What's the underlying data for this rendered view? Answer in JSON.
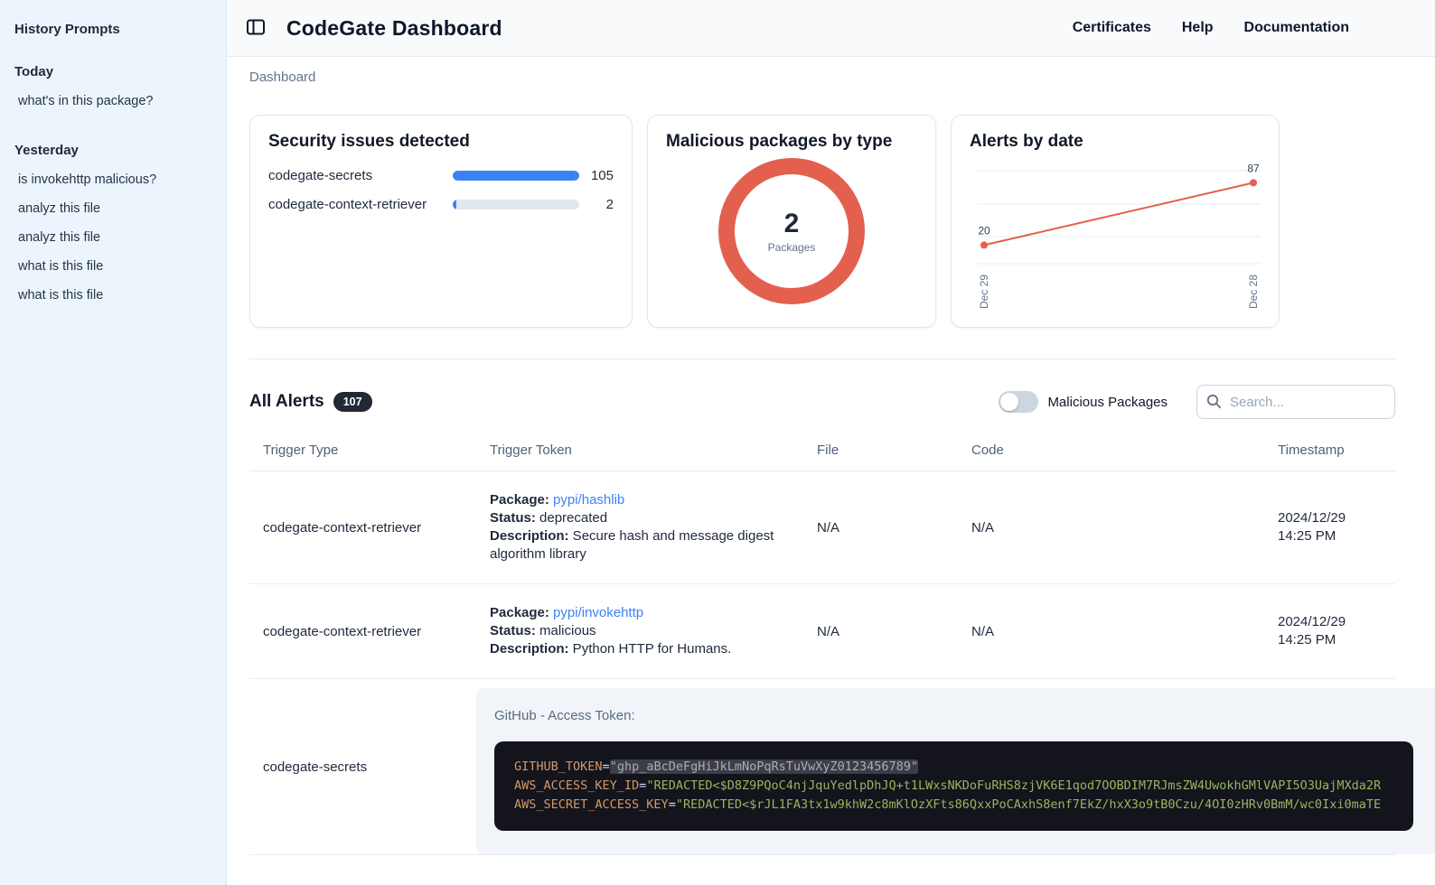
{
  "colors": {
    "accent_blue": "#3b82f6",
    "coral": "#e4604e",
    "link_blue": "#3b82f6",
    "code_key": "#d19a66",
    "code_string": "#98b45f"
  },
  "sidebar": {
    "title": "History Prompts",
    "sections": [
      {
        "label": "Today",
        "items": [
          "what's in this package?"
        ]
      },
      {
        "label": "Yesterday",
        "items": [
          "is invokehttp malicious?",
          "analyz this file",
          "analyz this file",
          "what is this file",
          "what is this file"
        ]
      }
    ]
  },
  "header": {
    "title": "CodeGate Dashboard",
    "nav": [
      {
        "label": "Certificates"
      },
      {
        "label": "Help"
      },
      {
        "label": "Documentation"
      }
    ]
  },
  "breadcrumb": "Dashboard",
  "cards": {
    "security": {
      "title": "Security issues detected"
    },
    "malicious": {
      "title": "Malicious packages by type"
    },
    "alerts_by_date": {
      "title": "Alerts by date"
    }
  },
  "chart_data": [
    {
      "type": "bar",
      "title": "Security issues detected",
      "categories": [
        "codegate-secrets",
        "codegate-context-retriever"
      ],
      "values": [
        105,
        2
      ],
      "max": 105
    },
    {
      "type": "pie",
      "title": "Malicious packages by type",
      "categories": [
        "malicious"
      ],
      "values": [
        2
      ],
      "center": "2",
      "center_label": "Packages"
    },
    {
      "type": "line",
      "title": "Alerts by date",
      "categories": [
        "Dec 29",
        "Dec 28"
      ],
      "values": [
        20,
        87
      ],
      "point_labels": [
        "20",
        "87"
      ],
      "ylim": [
        0,
        100
      ],
      "grid": true
    }
  ],
  "alerts_section": {
    "title": "All Alerts",
    "count_badge": "107",
    "toggle_label": "Malicious Packages",
    "search_placeholder": "Search...",
    "table": {
      "columns": [
        "Trigger Type",
        "Trigger Token",
        "File",
        "Code",
        "Timestamp"
      ],
      "rows": [
        {
          "type": "package",
          "trigger_type": "codegate-context-retriever",
          "package_label": "Package:",
          "package_link": "pypi/hashlib",
          "status_label": "Status:",
          "status": "deprecated",
          "description_label": "Description:",
          "description": "Secure hash and message digest algorithm library",
          "file": "N/A",
          "code": "N/A",
          "timestamp_date": "2024/12/29",
          "timestamp_time": "14:25 PM"
        },
        {
          "type": "package",
          "trigger_type": "codegate-context-retriever",
          "package_label": "Package:",
          "package_link": "pypi/invokehttp",
          "status_label": "Status:",
          "status": "malicious",
          "description_label": "Description:",
          "description": "Python HTTP for Humans.",
          "file": "N/A",
          "code": "N/A",
          "timestamp_date": "2024/12/29",
          "timestamp_time": "14:25 PM"
        },
        {
          "type": "secrets",
          "trigger_type": "codegate-secrets",
          "panel_label": "GitHub - Access Token:",
          "code_lines": [
            {
              "key": "GITHUB_TOKEN",
              "value": "\"ghp_aBcDeFgHiJkLmNoPqRsTuVwXyZ0123456789\"",
              "highlighted": true
            },
            {
              "key": "AWS_ACCESS_KEY_ID",
              "value": "\"REDACTED<$D8Z9PQoC4njJquYedlpDhJQ+t1LWxsNKDoFuRHS8zjVK6E1qod7OOBDIM7RJmsZW4UwokhGMlVAPI5O3UajMXda2R",
              "highlighted": false
            },
            {
              "key": "AWS_SECRET_ACCESS_KEY",
              "value": "\"REDACTED<$rJL1FA3tx1w9khW2c8mKlOzXFts86QxxPoCAxhS8enf7EkZ/hxX3o9tB0Czu/4OI0zHRv0BmM/wc0Ixi0maTE",
              "highlighted": false
            }
          ]
        }
      ]
    }
  }
}
